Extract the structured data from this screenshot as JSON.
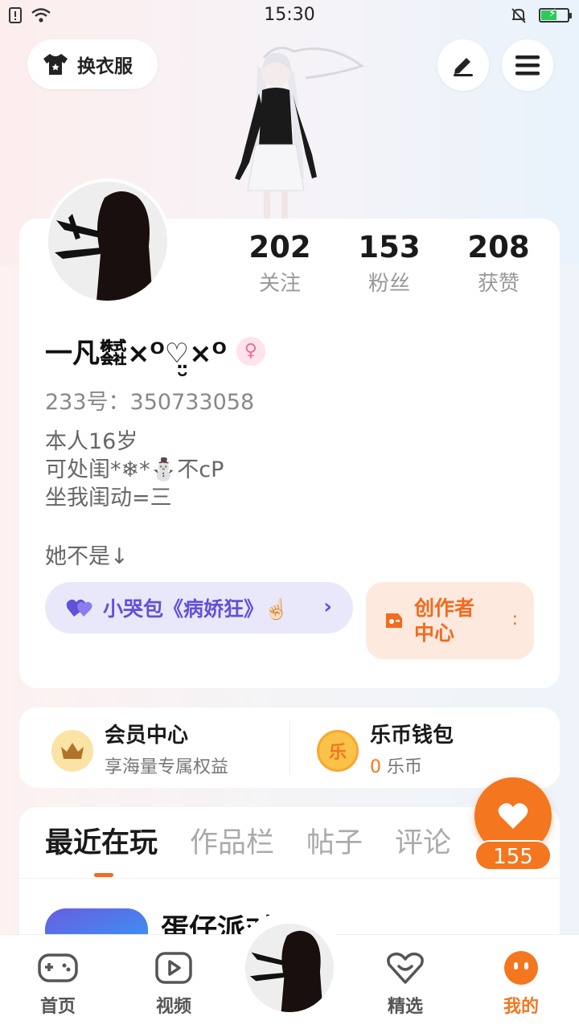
{
  "status_bar": {
    "time": "15:30"
  },
  "header": {
    "outfit_label": "换衣服"
  },
  "stats": [
    {
      "num": "202",
      "label": "关注"
    },
    {
      "num": "153",
      "label": "粉丝"
    },
    {
      "num": "208",
      "label": "获赞"
    }
  ],
  "profile": {
    "nickname": "一凡㍿×ᴼ♡̤̮×ᴼ",
    "gender_symbol": "♀",
    "id_line": "233号：350733058",
    "bio_lines": [
      "本人16岁",
      "可处闺*❄*⛄不cP",
      "坐我闺动=三"
    ],
    "bio_extra": "她不是↓",
    "badge_text": "小哭包《病娇狂》☝🏻",
    "creator_text": "创作者中心"
  },
  "member": {
    "title": "会员中心",
    "subtitle": "享海量专属权益"
  },
  "wallet": {
    "title": "乐币钱包",
    "coins": "0",
    "unit": "乐币",
    "icon_char": "乐"
  },
  "tabs": [
    "最近在玩",
    "作品栏",
    "帖子",
    "评论"
  ],
  "recent_game": {
    "title": "蛋仔派对"
  },
  "like": {
    "count": "155"
  },
  "bottom_nav": [
    {
      "label": "首页"
    },
    {
      "label": "视频"
    },
    {
      "label": "精选"
    },
    {
      "label": "我的"
    }
  ],
  "colors": {
    "accent": "#f4761f",
    "badge_purple": "#6151d9",
    "badge_bg": "#e9e8fb"
  }
}
